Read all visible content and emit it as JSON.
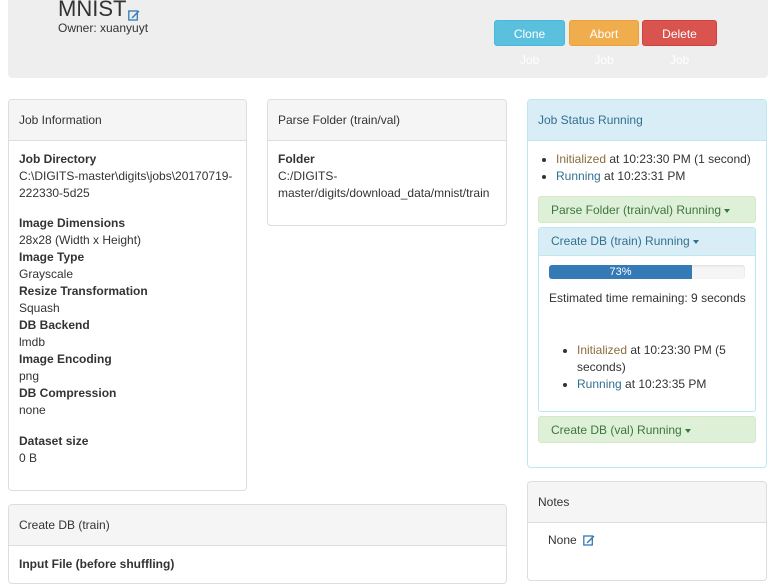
{
  "job": {
    "title": "MNIST",
    "owner": "Owner: xuanyuyt",
    "buttons": {
      "clone": "Clone Job",
      "abort": "Abort Job",
      "delete": "Delete Job"
    }
  },
  "info": {
    "heading": "Job Information",
    "dir_label": "Job Directory",
    "dir_line1": "C:\\DIGITS-master\\digits\\jobs\\20170719-",
    "dir_line2": "222330-5d25",
    "dims_label": "Image Dimensions",
    "dims_value": "28x28 (Width x Height)",
    "type_label": "Image Type",
    "type_value": "Grayscale",
    "resize_label": "Resize Transformation",
    "resize_value": "Squash",
    "backend_label": "DB Backend",
    "backend_value": "lmdb",
    "encoding_label": "Image Encoding",
    "encoding_value": "png",
    "compression_label": "DB Compression",
    "compression_value": "none",
    "size_label": "Dataset size",
    "size_value": "0 B"
  },
  "parse": {
    "heading": "Parse Folder (train/val)",
    "folder_label": "Folder",
    "folder_line1": "C:/DIGITS-",
    "folder_line2": "master/digits/download_data/mnist/train"
  },
  "createdb": {
    "heading": "Create DB (train)",
    "input_label": "Input File (before shuffling)"
  },
  "status": {
    "heading": "Job Status Running",
    "init_state": "Initialized",
    "init_rest": " at 10:23:30 PM (1 second)",
    "run_state": "Running",
    "run_rest": " at 10:23:31 PM",
    "parse_task": "Parse Folder (train/val) Running",
    "train_task": "Create DB (train) Running",
    "progress_label": "73%",
    "progress_value": 0.73,
    "eta": "Estimated time remaining: 9 seconds",
    "train_init_state": "Initialized",
    "train_init_rest": " at 10:23:30 PM (5 seconds)",
    "train_run_state": "Running",
    "train_run_rest": " at 10:23:35 PM",
    "val_task": "Create DB (val) Running"
  },
  "notes": {
    "heading": "Notes",
    "value": "None"
  },
  "colors": {
    "clone": "#5bc0de",
    "abort": "#f0ad4e",
    "delete": "#d9534f",
    "progress": "#337ab7",
    "success_bg": "#dff0d8",
    "info_bg": "#d9edf7"
  }
}
